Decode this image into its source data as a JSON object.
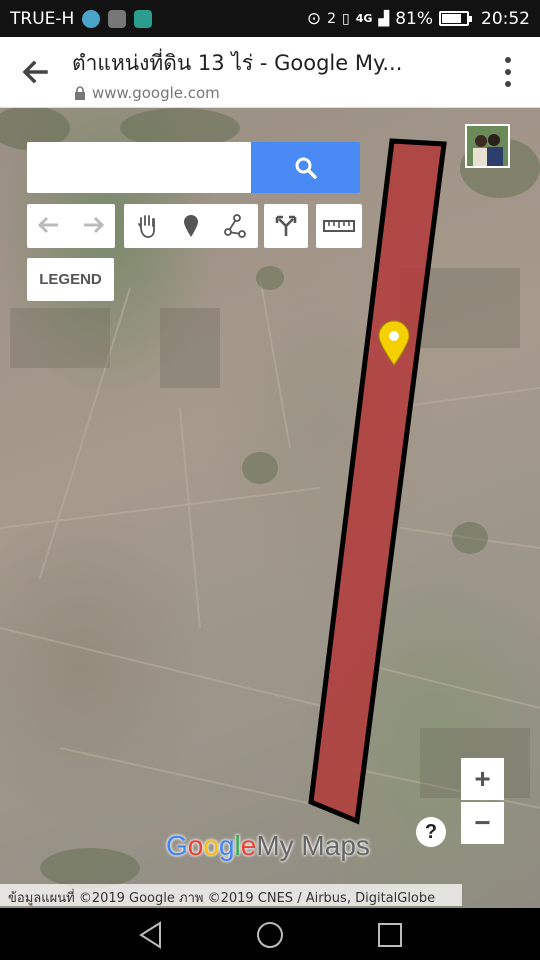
{
  "status_bar": {
    "carrier": "TRUE-H",
    "sim_label": "2",
    "network": "4G",
    "battery_percent": "81%",
    "battery_level": 0.81,
    "time": "20:52"
  },
  "browser": {
    "title": "ตำแหน่งที่ดิน 13 ไร่ - Google My...",
    "url": "www.google.com"
  },
  "map": {
    "search": {
      "value": "",
      "placeholder": ""
    },
    "toolbar": [
      "undo-icon",
      "redo-icon",
      "pan-hand-icon",
      "add-marker-icon",
      "draw-line-icon",
      "directions-icon",
      "measure-ruler-icon"
    ],
    "legend_label": "LEGEND",
    "zoom_in_label": "+",
    "zoom_out_label": "−",
    "help_label": "?",
    "brand": {
      "google": [
        "G",
        "o",
        "o",
        "g",
        "l",
        "e"
      ],
      "suffix": "My Maps"
    },
    "copyright": "ข้อมูลแผนที่ ©2019 Google ภาพ ©2019 CNES / Airbus, DigitalGlobe",
    "colors": {
      "parcel_fill": "#b23a3a",
      "parcel_stroke": "#000000",
      "marker": "#f5d000",
      "search_button": "#4a8af4"
    }
  },
  "nav_bar": [
    "back-icon",
    "home-icon",
    "recents-icon"
  ]
}
